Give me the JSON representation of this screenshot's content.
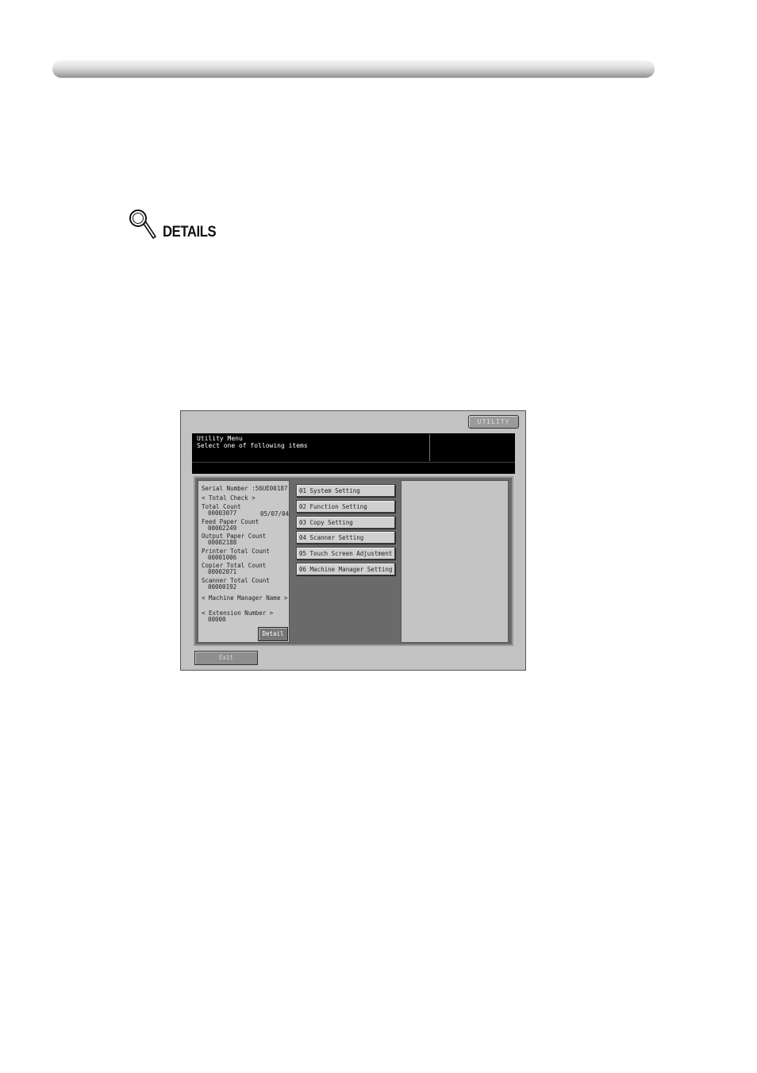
{
  "details_heading": "DETAILS",
  "screen": {
    "utility_button": "UTILITY",
    "header_line1": "Utility Menu",
    "header_line2": "Select one of following items",
    "counters": {
      "serial_number": "Serial Number  :56UE00187",
      "total_check": "< Total Check >",
      "total_count_label": "Total Count",
      "total_count_value": "00003077",
      "date": "05/07/04",
      "feed_paper_label": "Feed Paper Count",
      "feed_paper_value": "00002249",
      "output_paper_label": "Output Paper Count",
      "output_paper_value": "00002188",
      "printer_total_label": "Printer Total Count",
      "printer_total_value": "00001006",
      "copier_total_label": "Copier Total Count",
      "copier_total_value": "00002071",
      "scanner_total_label": "Scanner Total Count",
      "scanner_total_value": "00000192",
      "machine_manager_name": "< Machine Manager Name >",
      "extension_number_label": "< Extension Number >",
      "extension_number_value": "00000",
      "detail_button": "Detail"
    },
    "menu_items": [
      "01 System Setting",
      "02 Function Setting",
      "03 Copy Setting",
      "04 Scanner Setting",
      "05 Touch Screen Adjustment",
      "06 Machine Manager Setting"
    ],
    "exit_button": "Exit"
  }
}
